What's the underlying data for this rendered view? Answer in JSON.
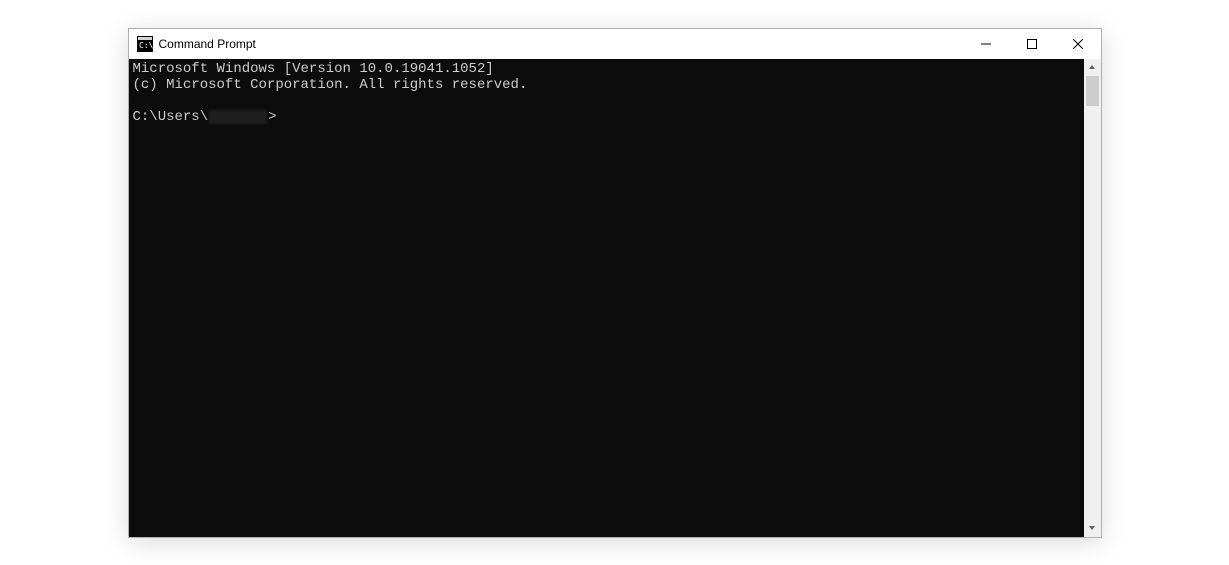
{
  "window": {
    "title": "Command Prompt"
  },
  "terminal": {
    "line1": "Microsoft Windows [Version 10.0.19041.1052]",
    "line2": "(c) Microsoft Corporation. All rights reserved.",
    "prompt_prefix": "C:\\Users\\",
    "prompt_suffix": ">"
  }
}
